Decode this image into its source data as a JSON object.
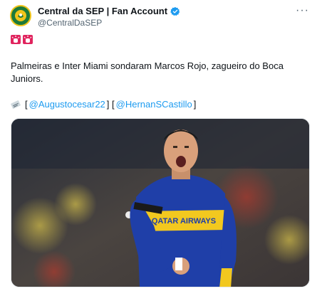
{
  "author": {
    "display_name": "Central da SEP | Fan Account",
    "handle": "@CentralDaSEP",
    "verified": true,
    "avatar_icon": "football-club-crest-icon"
  },
  "actions": {
    "more_label": "···"
  },
  "tweet": {
    "emojis": [
      "flashing-light-emoji",
      "flashing-light-emoji"
    ],
    "text": "Palmeiras e Inter Miami sondaram Marcos Rojo, zagueiro do Boca Juniors.",
    "credit_icon": "newspaper-icon",
    "credit_open": "[",
    "mention_1": "@Augustocesar22",
    "credit_mid": "] [",
    "mention_2": "@HernanSCastillo",
    "credit_close": "]"
  },
  "media": {
    "shirt_text": "QATAR AIRWAYS",
    "colors": {
      "boca_blue": "#1f3fa8",
      "boca_yellow": "#f2c81f"
    }
  },
  "colors": {
    "link": "#1d9bf0",
    "secondary_text": "#536471",
    "verified": "#1d9bf0"
  }
}
